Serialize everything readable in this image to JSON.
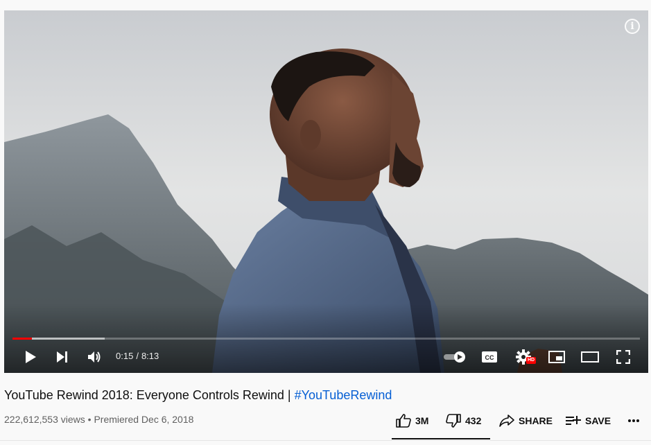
{
  "player": {
    "info_symbol": "i",
    "current_time": "0:15",
    "separator": "/",
    "duration": "8:13",
    "progress_fraction": 0.031,
    "buffered_fraction": 0.147,
    "hd_badge": "HD",
    "icons": [
      "play-icon",
      "next-icon",
      "volume-icon",
      "autoplay-toggle-icon",
      "captions-icon",
      "settings-icon",
      "miniplayer-icon",
      "theater-mode-icon",
      "fullscreen-icon",
      "info-icon"
    ]
  },
  "video": {
    "title_prefix": "YouTube Rewind 2018: Everyone Controls Rewind | ",
    "hashtag": "#YouTubeRewind",
    "views": "222,612,553 views",
    "meta_separator": "•",
    "premiere": "Premiered Dec 6, 2018"
  },
  "actions": {
    "likes": "3M",
    "dislikes": "432",
    "share": "SHARE",
    "save": "SAVE"
  },
  "colors": {
    "accent": "#ff0000",
    "link": "#065fd4",
    "background": "#f9f9f9"
  }
}
